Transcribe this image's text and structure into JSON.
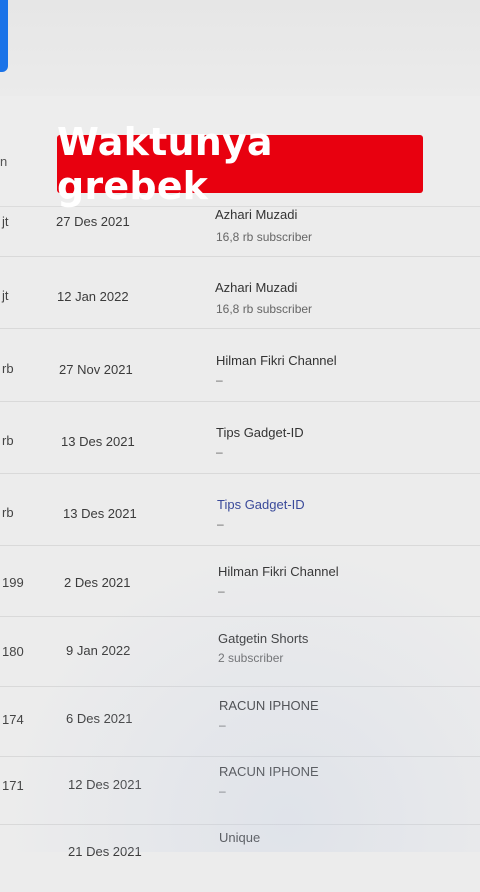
{
  "header": {
    "column_fragment": "n"
  },
  "banner": {
    "text": "Waktunya grebek"
  },
  "rows": [
    {
      "views": "jt",
      "date": "27 Des 2021",
      "channel": "Azhari Muzadi",
      "subscribers": "16,8 rb subscriber"
    },
    {
      "views": "jt",
      "date": "12 Jan 2022",
      "channel": "Azhari Muzadi",
      "subscribers": "16,8 rb subscriber"
    },
    {
      "views": "rb",
      "date": "27 Nov 2021",
      "channel": "Hilman Fikri Channel",
      "subscribers": "–"
    },
    {
      "views": "rb",
      "date": "13 Des 2021",
      "channel": "Tips Gadget-ID",
      "subscribers": "–"
    },
    {
      "views": "rb",
      "date": "13 Des 2021",
      "channel": "Tips Gadget-ID",
      "subscribers": "–"
    },
    {
      "views": "199",
      "date": "2 Des 2021",
      "channel": "Hilman Fikri Channel",
      "subscribers": "–"
    },
    {
      "views": "180",
      "date": "9 Jan 2022",
      "channel": "Gatgetin Shorts",
      "subscribers": "2 subscriber"
    },
    {
      "views": "174",
      "date": "6 Des 2021",
      "channel": "RACUN IPHONE",
      "subscribers": "–"
    },
    {
      "views": "171",
      "date": "12 Des 2021",
      "channel": "RACUN IPHONE",
      "subscribers": "–"
    },
    {
      "views": "",
      "date": "21 Des 2021",
      "channel": "Unique",
      "subscribers": ""
    }
  ]
}
